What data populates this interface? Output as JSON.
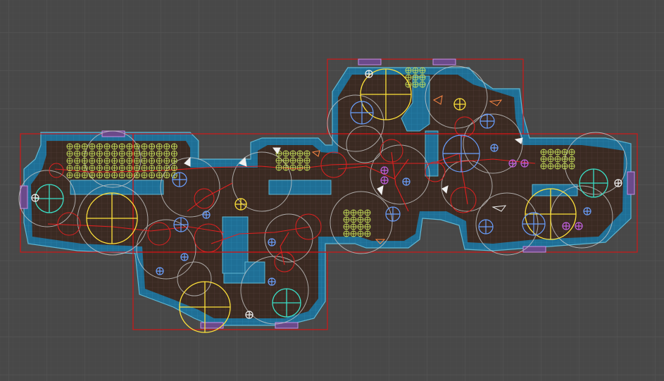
{
  "scene": {
    "name": "procedural-dungeon-level-gizmo-view",
    "colors": {
      "background": "#484848",
      "grid_major": "#575757",
      "room_bounds": "#d01818",
      "floor": "#3a2a22",
      "wall_fill": "#1f6f96",
      "wall_outline": "#5fb6d2",
      "door_marker": "#c58ee6",
      "enemy_marker": "#c7e05a",
      "trigger_circle": "#c8c8c8",
      "patrol_path": "#e02020",
      "spawn_marker": "#6aa0ff",
      "item_marker": "#ffe23a",
      "teleport_marker": "#3be0c8",
      "loot_marker": "#c060e0",
      "camera_marker": "#e8e8e8",
      "warning_marker": "#ff8844"
    },
    "icons": {
      "enemy": "crosshair-circle-icon",
      "spawn": "crosshair-circle-icon",
      "camera": "camera-gizmo-icon",
      "light": "light-cone-icon",
      "door": "door-marker-icon"
    }
  }
}
